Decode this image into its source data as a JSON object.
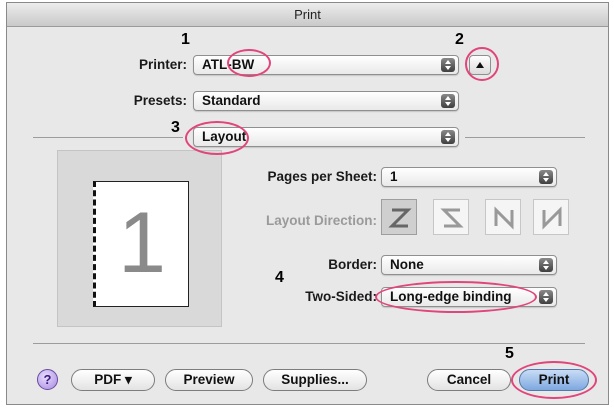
{
  "window": {
    "title": "Print"
  },
  "printer": {
    "label": "Printer:",
    "value": "ATL-BW"
  },
  "presets": {
    "label": "Presets:",
    "value": "Standard"
  },
  "section": {
    "value": "Layout"
  },
  "layout": {
    "pages_per_sheet": {
      "label": "Pages per Sheet:",
      "value": "1"
    },
    "layout_direction": {
      "label": "Layout Direction:",
      "selected_index": 0
    },
    "border": {
      "label": "Border:",
      "value": "None"
    },
    "two_sided": {
      "label": "Two-Sided:",
      "value": "Long-edge binding"
    }
  },
  "preview": {
    "page_number": "1"
  },
  "buttons": {
    "help": "?",
    "pdf": "PDF ▾",
    "preview": "Preview",
    "supplies": "Supplies...",
    "cancel": "Cancel",
    "print": "Print"
  },
  "callouts": [
    "1",
    "2",
    "3",
    "4",
    "5"
  ],
  "colors": {
    "annotation_circle": "#e0457b",
    "dialog_bg": "#e8e8e8",
    "default_button": "#7ea8e0"
  },
  "icons": [
    "popup-arrows-icon",
    "disclosure-triangle-icon",
    "layout-direction-icons",
    "help-icon"
  ]
}
